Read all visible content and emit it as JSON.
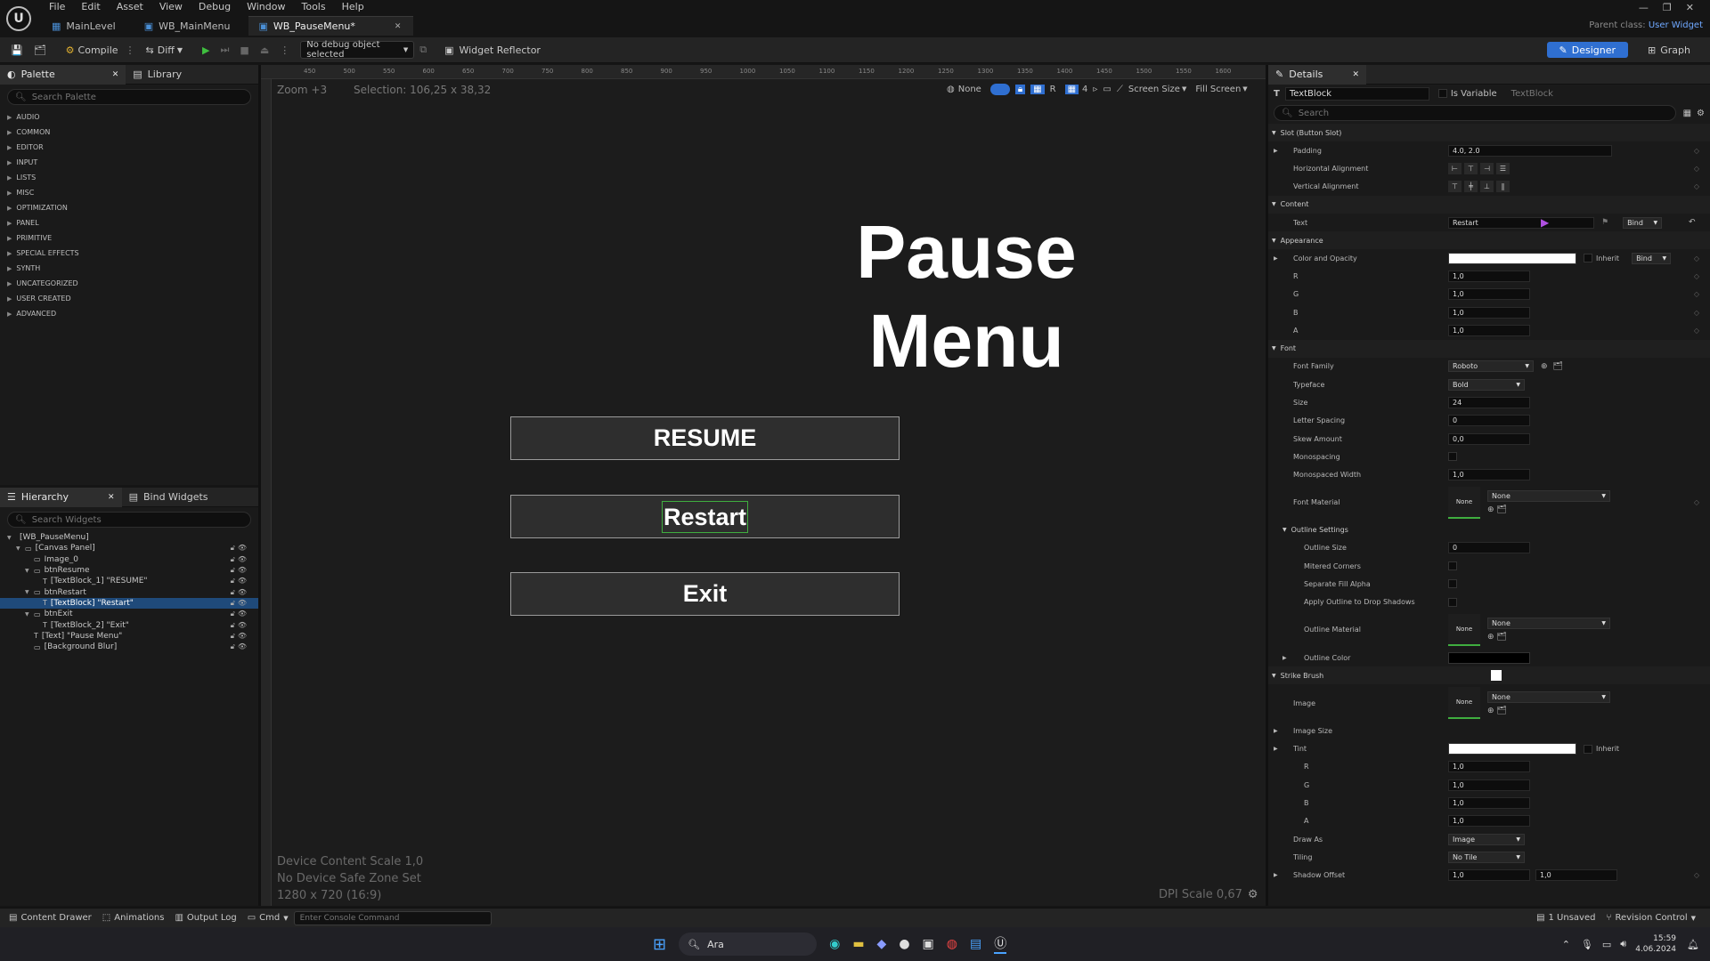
{
  "menubar": {
    "items": [
      "File",
      "Edit",
      "Asset",
      "View",
      "Debug",
      "Window",
      "Tools",
      "Help"
    ]
  },
  "tabs": [
    {
      "label": "MainLevel",
      "active": false
    },
    {
      "label": "WB_MainMenu",
      "active": false
    },
    {
      "label": "WB_PauseMenu*",
      "active": true
    }
  ],
  "parent_class": {
    "label": "Parent class:",
    "value": "User Widget"
  },
  "toolbar": {
    "compile": "Compile",
    "diff": "Diff",
    "debug_select": "No debug object selected",
    "widget_reflector": "Widget Reflector",
    "designer": "Designer",
    "graph": "Graph"
  },
  "palette": {
    "tab": "Palette",
    "library_tab": "Library",
    "search_placeholder": "Search Palette",
    "categories": [
      "AUDIO",
      "COMMON",
      "EDITOR",
      "INPUT",
      "LISTS",
      "MISC",
      "OPTIMIZATION",
      "PANEL",
      "PRIMITIVE",
      "SPECIAL EFFECTS",
      "SYNTH",
      "UNCATEGORIZED",
      "USER CREATED",
      "ADVANCED"
    ]
  },
  "hierarchy": {
    "tab": "Hierarchy",
    "bind_tab": "Bind Widgets",
    "search_placeholder": "Search Widgets",
    "rows": [
      {
        "label": "[WB_PauseMenu]",
        "indent": 0,
        "sel": false,
        "locks": false
      },
      {
        "label": "[Canvas Panel]",
        "indent": 1,
        "sel": false,
        "locks": true
      },
      {
        "label": "Image_0",
        "indent": 2,
        "sel": false,
        "locks": true
      },
      {
        "label": "btnResume",
        "indent": 2,
        "sel": false,
        "locks": true
      },
      {
        "label": "[TextBlock_1] \"RESUME\"",
        "indent": 3,
        "sel": false,
        "locks": true
      },
      {
        "label": "btnRestart",
        "indent": 2,
        "sel": false,
        "locks": true
      },
      {
        "label": "[TextBlock] \"Restart\"",
        "indent": 3,
        "sel": true,
        "locks": true
      },
      {
        "label": "btnExit",
        "indent": 2,
        "sel": false,
        "locks": true
      },
      {
        "label": "[TextBlock_2] \"Exit\"",
        "indent": 3,
        "sel": false,
        "locks": true
      },
      {
        "label": "[Text] \"Pause Menu\"",
        "indent": 2,
        "sel": false,
        "locks": true
      },
      {
        "label": "[Background Blur]",
        "indent": 2,
        "sel": false,
        "locks": true
      }
    ]
  },
  "viewport": {
    "zoom": "Zoom +3",
    "selection": "Selection: 106,25 x 38,32",
    "ruler_ticks": [
      "450",
      "500",
      "550",
      "600",
      "650",
      "700",
      "750",
      "800",
      "850",
      "900",
      "950",
      "1000",
      "1050",
      "1100",
      "1150",
      "1200",
      "1250",
      "1300",
      "1350",
      "1400",
      "1450",
      "1500",
      "1550",
      "1600"
    ],
    "none_label": "None",
    "r_label": "R",
    "grid_value": "4",
    "screen_size": "Screen Size",
    "fill_screen": "Fill Screen",
    "device_scale": "Device Content Scale 1,0",
    "safe_zone": "No Device Safe Zone Set",
    "resolution": "1280 x 720 (16:9)",
    "dpi": "DPI Scale 0,67",
    "title": "Pause Menu",
    "buttons": [
      "RESUME",
      "Restart",
      "Exit"
    ]
  },
  "details": {
    "tab": "Details",
    "widget_name": "TextBlock",
    "is_variable": "Is Variable",
    "widget_type": "TextBlock",
    "search_placeholder": "Search",
    "slot_section": "Slot (Button Slot)",
    "padding_label": "Padding",
    "padding_value": "4.0, 2.0",
    "h_align": "Horizontal Alignment",
    "v_align": "Vertical Alignment",
    "content_section": "Content",
    "text_label": "Text",
    "text_value": "Restart",
    "bind": "Bind",
    "appearance_section": "Appearance",
    "color_opacity": "Color and Opacity",
    "inherit": "Inherit",
    "r": "R",
    "g": "G",
    "b": "B",
    "a": "A",
    "one": "1,0",
    "font_section": "Font",
    "font_family": "Font Family",
    "font_family_value": "Roboto",
    "typeface": "Typeface",
    "typeface_value": "Bold",
    "size": "Size",
    "size_value": "24",
    "letter_spacing": "Letter Spacing",
    "letter_spacing_value": "0",
    "skew_amount": "Skew Amount",
    "skew_value": "0,0",
    "monospacing": "Monospacing",
    "monospaced_width": "Monospaced Width",
    "monospaced_width_value": "1,0",
    "font_material": "Font Material",
    "none": "None",
    "outline_settings": "Outline Settings",
    "outline_size": "Outline Size",
    "outline_size_value": "0",
    "mitered_corners": "Mitered Corners",
    "separate_fill_alpha": "Separate Fill Alpha",
    "apply_outline": "Apply Outline to Drop Shadows",
    "outline_material": "Outline Material",
    "outline_color": "Outline Color",
    "strike_brush": "Strike Brush",
    "image": "Image",
    "image_size": "Image Size",
    "tint": "Tint",
    "draw_as": "Draw As",
    "draw_as_value": "Image",
    "tiling": "Tiling",
    "tiling_value": "No Tile",
    "shadow_offset": "Shadow Offset",
    "shadow_x": "1,0",
    "shadow_y": "1,0"
  },
  "bottombar": {
    "content_drawer": "Content Drawer",
    "animations": "Animations",
    "output_log": "Output Log",
    "cmd": "Cmd",
    "console_placeholder": "Enter Console Command",
    "unsaved": "1 Unsaved",
    "revision": "Revision Control"
  },
  "taskbar": {
    "search": "Ara",
    "time": "15:59",
    "date": "4.06.2024"
  }
}
